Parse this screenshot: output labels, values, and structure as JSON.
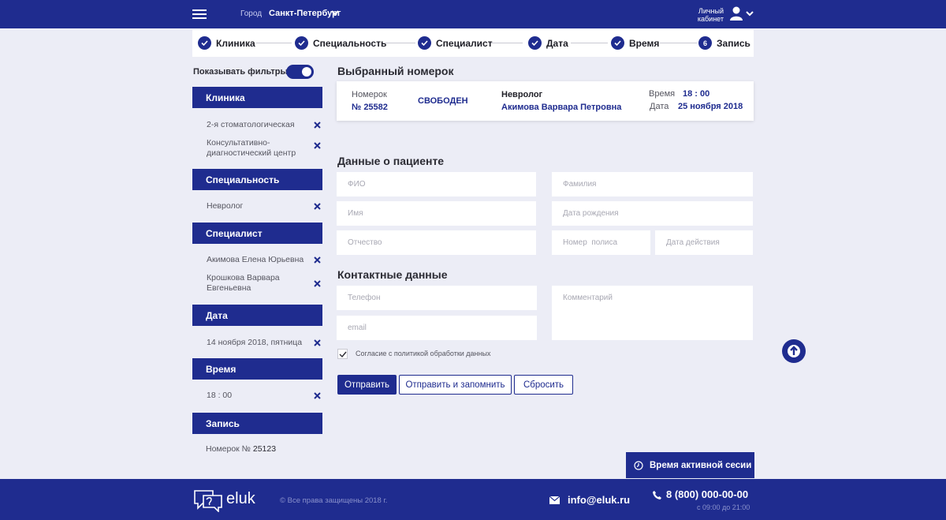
{
  "header": {
    "city_label": "Город",
    "city_value": "Санкт-Петербург",
    "cabinet_line1": "Личный",
    "cabinet_line2": "кабинет"
  },
  "steps": [
    {
      "label": "Клиника",
      "done": true
    },
    {
      "label": "Специальность",
      "done": true
    },
    {
      "label": "Специалист",
      "done": true
    },
    {
      "label": "Дата",
      "done": true
    },
    {
      "label": "Время",
      "done": true
    },
    {
      "label": "Запись",
      "number": "6"
    }
  ],
  "sidebar": {
    "toggle_label": "Показывать фильтры",
    "clinic": {
      "title": "Клиника",
      "items": [
        "2-я стоматологическая",
        "Консультативно-диагностический центр"
      ]
    },
    "specialty": {
      "title": "Специальность",
      "items": [
        "Невролог"
      ]
    },
    "specialist": {
      "title": "Специалист",
      "items": [
        "Акимова Елена Юрьевна",
        "Крошкова Варвара Евгеньевна"
      ]
    },
    "date": {
      "title": "Дата",
      "items": [
        "14 ноября 2018, пятница"
      ]
    },
    "time": {
      "title": "Время",
      "items": [
        "18 : 00"
      ]
    },
    "booking": {
      "title": "Запись",
      "label": "Номерок №",
      "number": "25123"
    }
  },
  "ticket": {
    "heading": "Выбранный номерок",
    "number_label": "Номерок",
    "number_value": "№ 25582",
    "status": "СВОБОДЕН",
    "specialty": "Невролог",
    "doctor": "Акимова Варвара Петровна",
    "time_label": "Время",
    "time_value": "18 : 00",
    "date_label": "Дата",
    "date_value": "25 ноября 2018"
  },
  "patient": {
    "heading": "Данные о пациенте",
    "fio_placeholder": "ФИО",
    "surname_placeholder": "Фамилия",
    "name_placeholder": "Имя",
    "birth_placeholder": "Дата рождения",
    "patronymic_placeholder": "Отчество",
    "policy_placeholder": "Номер  полиса",
    "validity_placeholder": "Дата действия"
  },
  "contacts": {
    "heading": "Контактные данные",
    "phone_placeholder": "Телефон",
    "email_placeholder": "email",
    "comment_placeholder": "Комментарий",
    "consent": "Согласие с политикой обработки данных"
  },
  "buttons": {
    "submit": "Отправить",
    "submit_remember": "Отправить и запомнить",
    "reset": "Сбросить",
    "session": "Время активной сесии"
  },
  "footer": {
    "logo": "eluk",
    "copyright": "© Все права защищены 2018 г.",
    "email": "info@eluk.ru",
    "phone": "8 (800) 000-00-00",
    "hours": "с 09:00 до 21:00"
  },
  "colors": {
    "brand": "#1f2c8f",
    "background": "#ecedf6"
  }
}
